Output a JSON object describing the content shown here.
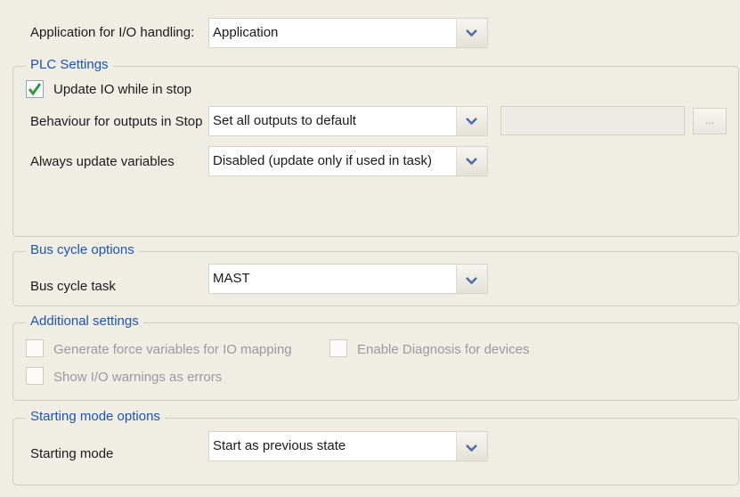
{
  "app_handling": {
    "label": "Application for I/O handling:",
    "value": "Application"
  },
  "plc_settings": {
    "legend": "PLC Settings",
    "update_io": {
      "label": "Update IO while in stop",
      "checked": true
    },
    "behaviour": {
      "label": "Behaviour for outputs in Stop",
      "value": "Set all outputs to default",
      "extra_value": "",
      "browse_label": "..."
    },
    "always_update": {
      "label": "Always update variables",
      "value": "Disabled (update only if used in task)"
    }
  },
  "bus_cycle": {
    "legend": "Bus cycle options",
    "task": {
      "label": "Bus cycle task",
      "value": "MAST"
    }
  },
  "additional": {
    "legend": "Additional settings",
    "force_vars": {
      "label": "Generate force variables for IO mapping",
      "checked": false,
      "enabled": false
    },
    "diagnosis": {
      "label": "Enable Diagnosis for devices",
      "checked": false,
      "enabled": false
    },
    "warnings": {
      "label": "Show I/O warnings as errors",
      "checked": false,
      "enabled": false
    }
  },
  "starting_mode": {
    "legend": "Starting mode options",
    "mode": {
      "label": "Starting mode",
      "value": "Start as previous state"
    }
  },
  "icons": {
    "dropdown": "chevron-down-icon",
    "check": "checkmark-icon"
  },
  "colors": {
    "legend": "#1f54b0",
    "check": "#2e9b3a",
    "arrow": "#4a6fa5"
  }
}
